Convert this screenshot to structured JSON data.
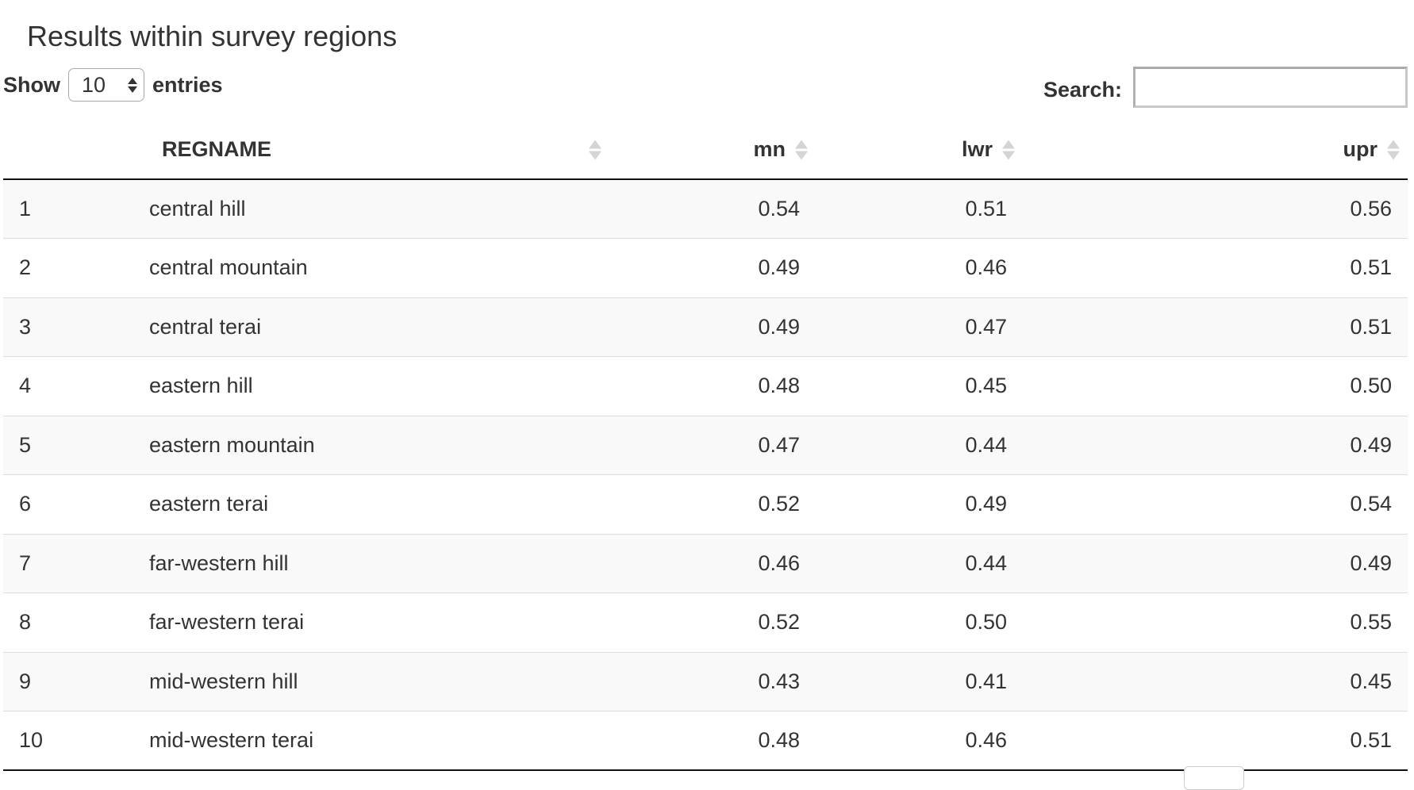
{
  "title": "Results within survey regions",
  "length_menu": {
    "show_label": "Show",
    "selected": "10",
    "entries_label": "entries"
  },
  "search": {
    "label": "Search:",
    "value": "",
    "placeholder": ""
  },
  "table": {
    "columns": [
      {
        "label": "",
        "align": "left",
        "sortable": false
      },
      {
        "label": "REGNAME",
        "align": "left",
        "sortable": true
      },
      {
        "label": "mn",
        "align": "right",
        "sortable": true
      },
      {
        "label": "lwr",
        "align": "right",
        "sortable": true
      },
      {
        "label": "upr",
        "align": "right",
        "sortable": true
      }
    ],
    "rows": [
      {
        "idx": "1",
        "regname": "central hill",
        "mn": "0.54",
        "lwr": "0.51",
        "upr": "0.56"
      },
      {
        "idx": "2",
        "regname": "central mountain",
        "mn": "0.49",
        "lwr": "0.46",
        "upr": "0.51"
      },
      {
        "idx": "3",
        "regname": "central terai",
        "mn": "0.49",
        "lwr": "0.47",
        "upr": "0.51"
      },
      {
        "idx": "4",
        "regname": "eastern hill",
        "mn": "0.48",
        "lwr": "0.45",
        "upr": "0.50"
      },
      {
        "idx": "5",
        "regname": "eastern mountain",
        "mn": "0.47",
        "lwr": "0.44",
        "upr": "0.49"
      },
      {
        "idx": "6",
        "regname": "eastern terai",
        "mn": "0.52",
        "lwr": "0.49",
        "upr": "0.54"
      },
      {
        "idx": "7",
        "regname": "far-western hill",
        "mn": "0.46",
        "lwr": "0.44",
        "upr": "0.49"
      },
      {
        "idx": "8",
        "regname": "far-western terai",
        "mn": "0.52",
        "lwr": "0.50",
        "upr": "0.55"
      },
      {
        "idx": "9",
        "regname": "mid-western hill",
        "mn": "0.43",
        "lwr": "0.41",
        "upr": "0.45"
      },
      {
        "idx": "10",
        "regname": "mid-western terai",
        "mn": "0.48",
        "lwr": "0.46",
        "upr": "0.51"
      }
    ]
  },
  "colors": {
    "text": "#333333",
    "stripe": "#f9f9f9",
    "row_border": "#dddddd",
    "header_border": "#111111",
    "sort_icon": "#d4d4d4"
  },
  "icons": {
    "sort": "sort-both-icon",
    "select_arrows": "updown-arrows-icon"
  }
}
